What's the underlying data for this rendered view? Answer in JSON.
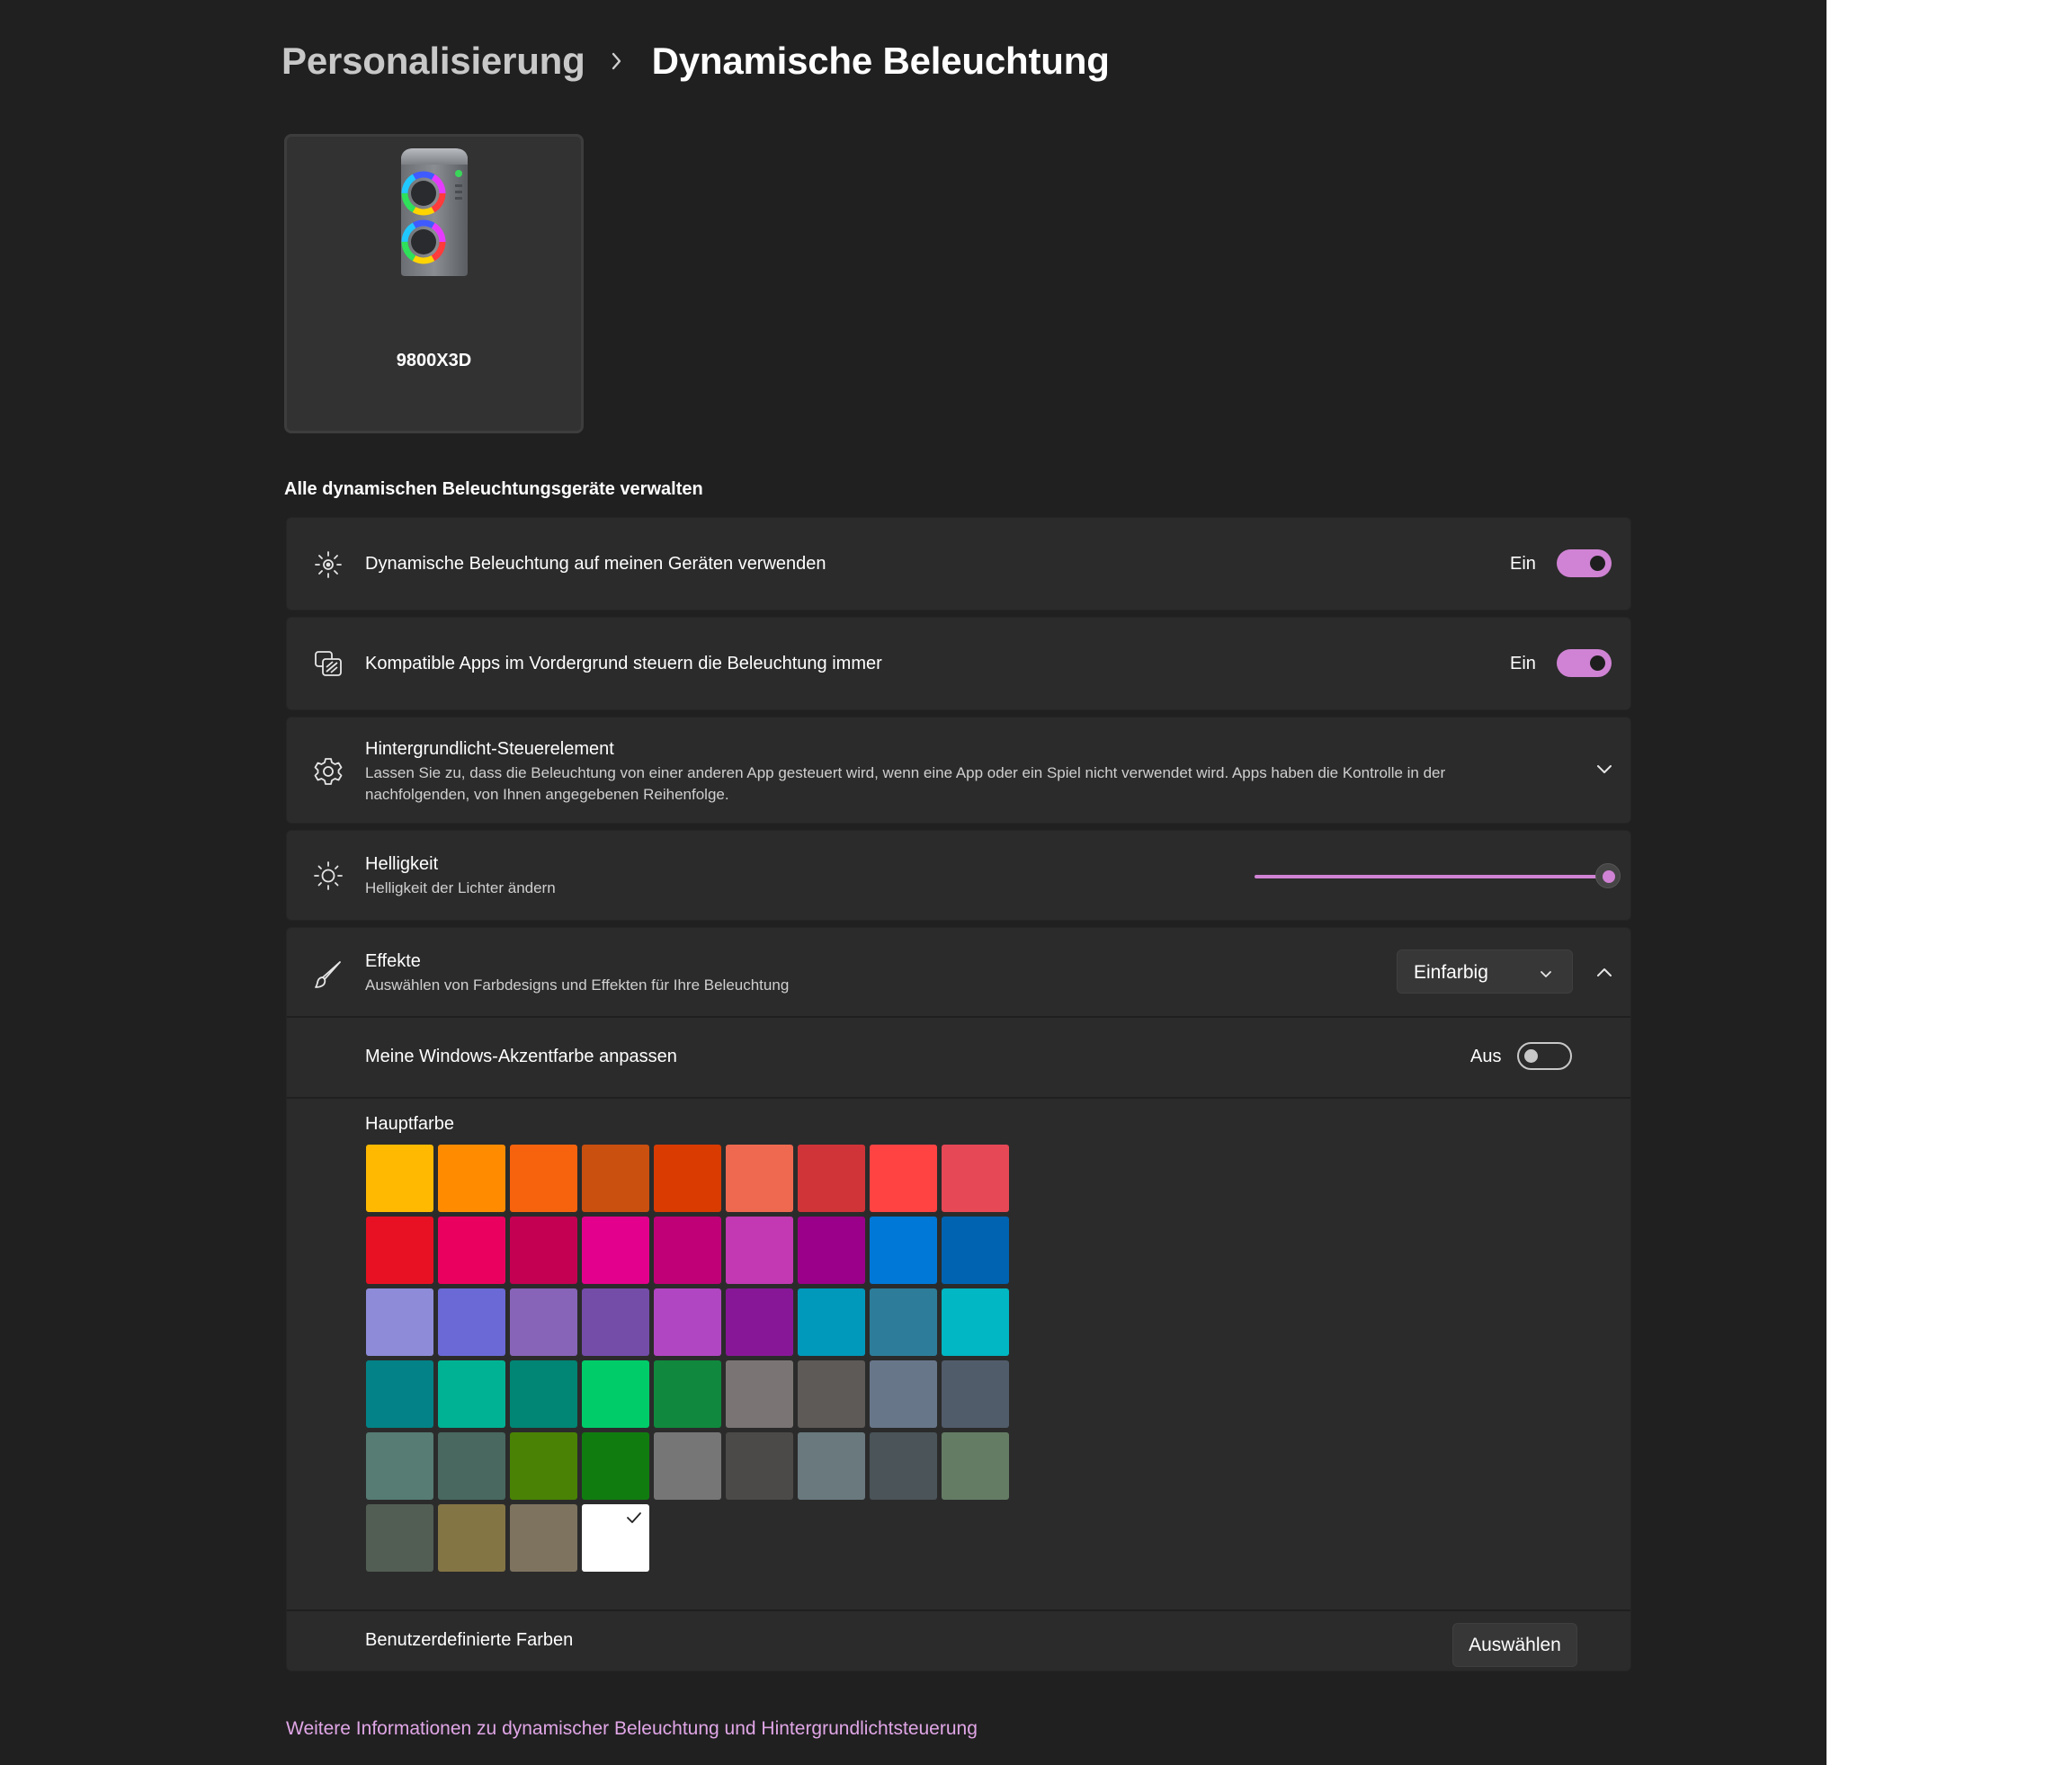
{
  "breadcrumb": {
    "parent": "Personalisierung",
    "current": "Dynamische Beleuchtung"
  },
  "device": {
    "name": "9800X3D",
    "icon": "pc-tower-rgb-icon"
  },
  "section_title": "Alle dynamischen Beleuchtungsgeräte verwalten",
  "settings": {
    "use_dynamic_lighting": {
      "icon": "lighting-icon",
      "title": "Dynamische Beleuchtung auf meinen Geräten verwenden",
      "state_label": "Ein",
      "on": true
    },
    "compatible_apps": {
      "icon": "apps-control-icon",
      "title": "Kompatible Apps im Vordergrund steuern die Beleuchtung immer",
      "state_label": "Ein",
      "on": true
    },
    "background_control": {
      "icon": "gear-icon",
      "title": "Hintergrundlicht-Steuerelement",
      "subtitle_line1": "Lassen Sie zu, dass die Beleuchtung von einer anderen App gesteuert wird, wenn eine App oder ein Spiel nicht verwendet wird. Apps haben die Kontrolle in der",
      "subtitle_line2": "nachfolgenden, von Ihnen angegebenen Reihenfolge."
    },
    "brightness": {
      "icon": "sun-icon",
      "title": "Helligkeit",
      "subtitle": "Helligkeit der Lichter ändern",
      "value": 100
    },
    "effects": {
      "icon": "brush-icon",
      "title": "Effekte",
      "subtitle": "Auswählen von Farbdesigns und Effekten für Ihre Beleuchtung",
      "dropdown_value": "Einfarbig",
      "accent_toggle": {
        "label": "Meine Windows-Akzentfarbe anpassen",
        "state_label": "Aus",
        "on": false
      },
      "main_color_label": "Hauptfarbe",
      "selected_color": "#FFFFFF",
      "colors": [
        "#FFB900",
        "#FF8C00",
        "#F7630C",
        "#CA5010",
        "#DA3B01",
        "#EF6950",
        "#D13438",
        "#FF4343",
        "#E74856",
        "#E81123",
        "#EA005E",
        "#C30052",
        "#E3008C",
        "#BF0077",
        "#C239B3",
        "#9A0089",
        "#0078D7",
        "#0063B1",
        "#8E8CD8",
        "#6B69D6",
        "#8764B8",
        "#744DA9",
        "#B146C2",
        "#881798",
        "#0099BC",
        "#2D7D9A",
        "#00B7C3",
        "#038387",
        "#00B294",
        "#018574",
        "#00CC6A",
        "#10893E",
        "#7A7574",
        "#5D5A58",
        "#68768A",
        "#515C6B",
        "#567C73",
        "#486860",
        "#498205",
        "#107C10",
        "#767676",
        "#4C4A48",
        "#69797E",
        "#4A5459",
        "#647C64",
        "#525E54",
        "#847545",
        "#7E735F",
        "#FFFFFF"
      ],
      "custom_colors_label": "Benutzerdefinierte Farben",
      "custom_colors_button": "Auswählen"
    }
  },
  "footer_link": "Weitere Informationen zu dynamischer Beleuchtung und Hintergrundlichtsteuerung",
  "accent_color": "#D083D4"
}
